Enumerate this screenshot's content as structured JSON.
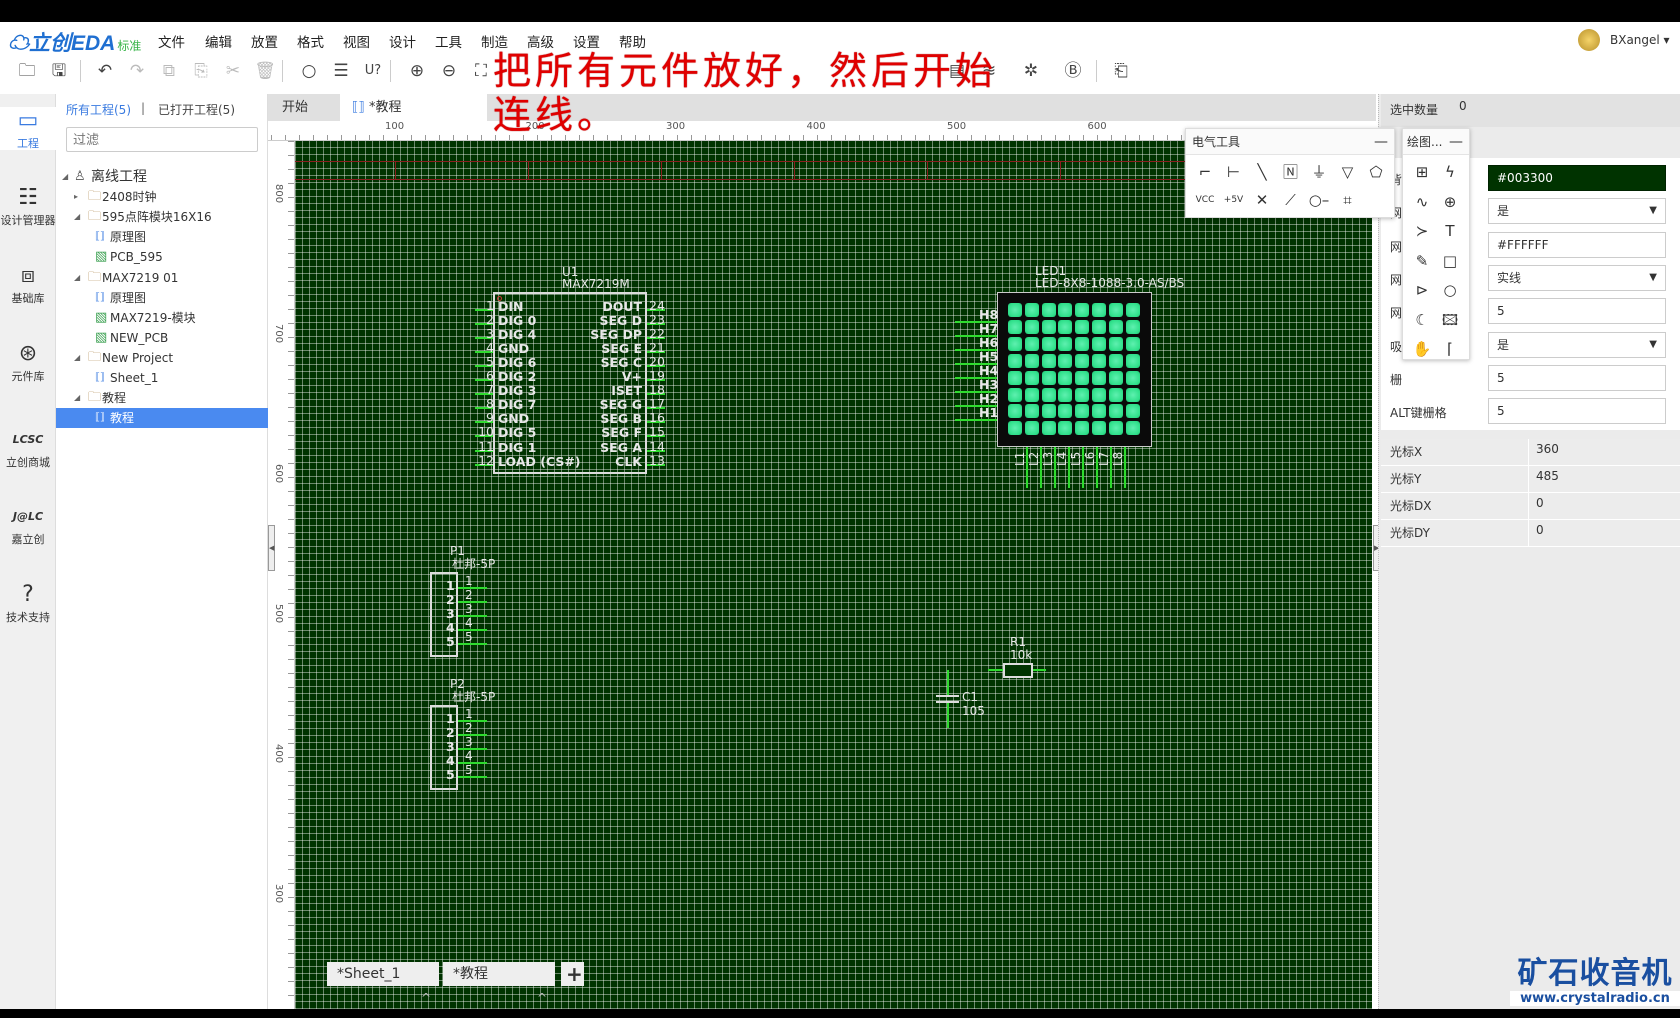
{
  "header": {
    "logo": "立创EDA",
    "edition": "标准",
    "menu": [
      "文件",
      "编辑",
      "放置",
      "格式",
      "视图",
      "设计",
      "工具",
      "制造",
      "高级",
      "设置",
      "帮助"
    ],
    "user": "BXangel ▾"
  },
  "toolbar": {
    "icons": [
      {
        "name": "open-icon",
        "glyph": "🗀"
      },
      {
        "name": "save-icon",
        "glyph": "🖫"
      },
      {
        "name": "undo-icon",
        "glyph": "↶"
      },
      {
        "name": "redo-icon",
        "glyph": "↷",
        "disabled": true
      },
      {
        "name": "duplicate-icon",
        "glyph": "⧉",
        "disabled": true
      },
      {
        "name": "paste-icon",
        "glyph": "⎘",
        "disabled": true
      },
      {
        "name": "cut-icon",
        "glyph": "✂",
        "disabled": true
      },
      {
        "name": "delete-icon",
        "glyph": "🗑",
        "disabled": true
      },
      {
        "name": "search-icon",
        "glyph": "○"
      },
      {
        "name": "find-icon",
        "glyph": "☰"
      },
      {
        "name": "annotate-icon",
        "glyph": "U?"
      },
      {
        "name": "zoom-in-icon",
        "glyph": "⊕"
      },
      {
        "name": "zoom-out-icon",
        "glyph": "⊖"
      },
      {
        "name": "fit-icon",
        "glyph": "⛶"
      },
      {
        "name": "bom-icon",
        "glyph": "▤"
      },
      {
        "name": "layers-icon",
        "glyph": "≋"
      },
      {
        "name": "drc-icon",
        "glyph": "✲"
      },
      {
        "name": "b-icon",
        "glyph": "Ⓑ"
      },
      {
        "name": "import-icon",
        "glyph": "⎗"
      }
    ]
  },
  "annotation": {
    "line1": "把所有元件放好，然后开始",
    "line2": "连线。"
  },
  "leftnav": [
    {
      "label": "工程",
      "icon": "▭"
    },
    {
      "label": "设计管理器",
      "icon": "☷"
    },
    {
      "label": "基础库",
      "icon": "⧈"
    },
    {
      "label": "元件库",
      "icon": "⊛"
    },
    {
      "label": "立创商城",
      "icon": "LCSC"
    },
    {
      "label": "嘉立创",
      "icon": "J@LC"
    },
    {
      "label": "技术支持",
      "icon": "?"
    }
  ],
  "projects": {
    "tab_all": "所有工程(5)",
    "sep": "|",
    "tab_open": "已打开工程(5)",
    "filter_placeholder": "过滤",
    "tree": [
      {
        "label": "离线工程",
        "level": 0,
        "type": "user",
        "arrow": "◢"
      },
      {
        "label": "2408时钟",
        "level": 1,
        "type": "folder",
        "arrow": "▸"
      },
      {
        "label": "595点阵模块16X16",
        "level": 1,
        "type": "folder",
        "arrow": "◢"
      },
      {
        "label": "原理图",
        "level": 2,
        "type": "sch"
      },
      {
        "label": "PCB_595",
        "level": 2,
        "type": "pcb"
      },
      {
        "label": "MAX7219 01",
        "level": 1,
        "type": "folder",
        "arrow": "◢"
      },
      {
        "label": "原理图",
        "level": 2,
        "type": "sch"
      },
      {
        "label": "MAX7219-模块",
        "level": 2,
        "type": "pcb"
      },
      {
        "label": "NEW_PCB",
        "level": 2,
        "type": "pcb"
      },
      {
        "label": "New Project",
        "level": 1,
        "type": "folder",
        "arrow": "◢"
      },
      {
        "label": "Sheet_1",
        "level": 2,
        "type": "sch"
      },
      {
        "label": "教程",
        "level": 1,
        "type": "folder",
        "arrow": "◢"
      },
      {
        "label": "教程",
        "level": 2,
        "type": "sch",
        "selected": true
      }
    ]
  },
  "doc_tabs": {
    "start": "开始",
    "current": "*教程"
  },
  "rulers": {
    "top": [
      "100",
      "200",
      "300",
      "400",
      "500",
      "600"
    ],
    "left": [
      "800",
      "700",
      "600",
      "500",
      "400",
      "300"
    ]
  },
  "schematic": {
    "u1": {
      "ref": "U1",
      "part": "MAX7219M",
      "left": [
        [
          "1",
          "DIN"
        ],
        [
          "2",
          "DIG 0"
        ],
        [
          "3",
          "DIG 4"
        ],
        [
          "4",
          "GND"
        ],
        [
          "5",
          "DIG 6"
        ],
        [
          "6",
          "DIG 2"
        ],
        [
          "7",
          "DIG 3"
        ],
        [
          "8",
          "DIG 7"
        ],
        [
          "9",
          "GND"
        ],
        [
          "10",
          "DIG 5"
        ],
        [
          "11",
          "DIG 1"
        ],
        [
          "12",
          "LOAD (CS#)"
        ]
      ],
      "right": [
        [
          "24",
          "DOUT"
        ],
        [
          "23",
          "SEG D"
        ],
        [
          "22",
          "SEG DP"
        ],
        [
          "21",
          "SEG E"
        ],
        [
          "20",
          "SEG C"
        ],
        [
          "19",
          "V+"
        ],
        [
          "18",
          "ISET"
        ],
        [
          "17",
          "SEG G"
        ],
        [
          "16",
          "SEG B"
        ],
        [
          "15",
          "SEG F"
        ],
        [
          "14",
          "SEG A"
        ],
        [
          "13",
          "CLK"
        ]
      ]
    },
    "led1": {
      "ref": "LED1",
      "part": "LED-8X8-1088-3.0-AS/BS",
      "rows": [
        "H8",
        "H7",
        "H6",
        "H5",
        "H4",
        "H3",
        "H2",
        "H1"
      ],
      "cols": [
        "L1",
        "L2",
        "L3",
        "L4",
        "L5",
        "L6",
        "L7",
        "L8"
      ]
    },
    "p1": {
      "ref": "P1",
      "part": "杜邦-5P",
      "pins": [
        "1",
        "2",
        "3",
        "4",
        "5"
      ]
    },
    "p2": {
      "ref": "P2",
      "part": "杜邦-5P",
      "pins": [
        "1",
        "2",
        "3",
        "4",
        "5"
      ]
    },
    "r1": {
      "ref": "R1",
      "value": "10k"
    },
    "c1": {
      "ref": "C1",
      "value": "105"
    }
  },
  "electric_tools": {
    "title": "电气工具",
    "min": "—",
    "tools": [
      {
        "name": "wire-icon",
        "glyph": "⌐"
      },
      {
        "name": "bus-icon",
        "glyph": "⊢"
      },
      {
        "name": "bus-entry-icon",
        "glyph": "╲"
      },
      {
        "name": "net-label-icon",
        "glyph": "🄽"
      },
      {
        "name": "ground-icon",
        "glyph": "⏚"
      },
      {
        "name": "net-port-ground-icon",
        "glyph": "▽"
      },
      {
        "name": "net-port-icon",
        "glyph": "⬠"
      },
      {
        "name": "vcc-icon",
        "glyph": "VCC"
      },
      {
        "name": "plus5v-icon",
        "glyph": "+5V"
      },
      {
        "name": "no-connect-icon",
        "glyph": "✕"
      },
      {
        "name": "probe-icon",
        "glyph": "⟋"
      },
      {
        "name": "pin-icon",
        "glyph": "○–"
      },
      {
        "name": "group-icon",
        "glyph": "⌗"
      }
    ]
  },
  "drawing_tools": {
    "title": "绘图...",
    "min": "—",
    "tools": [
      {
        "name": "frame-icon",
        "glyph": "⊞"
      },
      {
        "name": "polyline-icon",
        "glyph": "ϟ"
      },
      {
        "name": "bezier-icon",
        "glyph": "∿"
      },
      {
        "name": "arc-icon",
        "glyph": "⊕"
      },
      {
        "name": "arrow-icon",
        "glyph": "≻"
      },
      {
        "name": "text-icon",
        "glyph": "T"
      },
      {
        "name": "freehand-icon",
        "glyph": "✎"
      },
      {
        "name": "rect-icon",
        "glyph": "□"
      },
      {
        "name": "polygon-icon",
        "glyph": "⊳"
      },
      {
        "name": "circle-icon",
        "glyph": "○"
      },
      {
        "name": "pie-icon",
        "glyph": "☾"
      },
      {
        "name": "image-icon",
        "glyph": "🖾"
      },
      {
        "name": "pan-icon",
        "glyph": "✋"
      },
      {
        "name": "origin-icon",
        "glyph": "⌈"
      }
    ]
  },
  "properties": {
    "selected_label": "选中数量",
    "selected_value": "0",
    "rows": [
      {
        "label": "背",
        "value": "#003300",
        "kind": "color"
      },
      {
        "label": "网",
        "value": "是",
        "kind": "select"
      },
      {
        "label": "网",
        "value": "#FFFFFF",
        "kind": "text"
      },
      {
        "label": "网",
        "value": "实线",
        "kind": "select"
      },
      {
        "label": "网",
        "value": "5",
        "kind": "text"
      },
      {
        "label": "吸",
        "value": "是",
        "kind": "select"
      },
      {
        "label": "栅",
        "value": "5",
        "kind": "text"
      },
      {
        "label": "ALT键栅格",
        "value": "5",
        "kind": "text"
      }
    ],
    "cursor": [
      {
        "label": "光标X",
        "value": "360"
      },
      {
        "label": "光标Y",
        "value": "485"
      },
      {
        "label": "光标DX",
        "value": "0"
      },
      {
        "label": "光标DY",
        "value": "0"
      }
    ]
  },
  "sheet_tabs": {
    "tabs": [
      "*Sheet_1",
      "*教程"
    ],
    "caret": "^",
    "add": "+"
  },
  "watermark": {
    "title": "矿石收音机",
    "url": "www.crystalradio.cn"
  },
  "colors": {
    "canvas_bg": "#003300",
    "pin": "#2fdc2f",
    "accent": "#4a8af0",
    "annotation": "#e00000"
  }
}
